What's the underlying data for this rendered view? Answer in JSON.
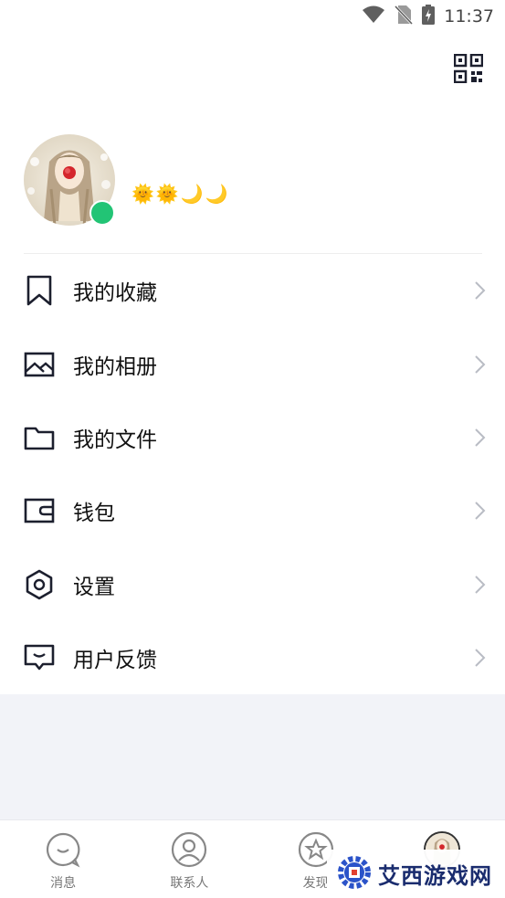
{
  "status_bar": {
    "time": "11:37",
    "icons": [
      "wifi-icon",
      "no-sim-icon",
      "battery-charging-icon"
    ]
  },
  "header": {
    "qr_icon": "qr-code-icon"
  },
  "profile": {
    "level_icons": [
      "sun-icon",
      "sun-icon",
      "moon-icon",
      "moon-icon"
    ],
    "status_color": "#22c475"
  },
  "menu": {
    "items": [
      {
        "label": "我的收藏",
        "icon": "bookmark-icon"
      },
      {
        "label": "我的相册",
        "icon": "image-icon"
      },
      {
        "label": "我的文件",
        "icon": "folder-icon"
      },
      {
        "label": "钱包",
        "icon": "wallet-icon"
      },
      {
        "label": "设置",
        "icon": "settings-hex-icon"
      },
      {
        "label": "用户反馈",
        "icon": "feedback-icon"
      }
    ]
  },
  "tabbar": {
    "tabs": [
      {
        "label": "消息",
        "icon": "message-icon"
      },
      {
        "label": "联系人",
        "icon": "contacts-icon"
      },
      {
        "label": "发现",
        "icon": "discover-star-icon"
      },
      {
        "label": "",
        "icon": "avatar"
      }
    ]
  },
  "watermark": {
    "text": "艾西游戏网"
  },
  "colors": {
    "accent_online": "#22c475",
    "background_gray": "#f2f3f8",
    "icon_dark": "#1c1f2e"
  }
}
